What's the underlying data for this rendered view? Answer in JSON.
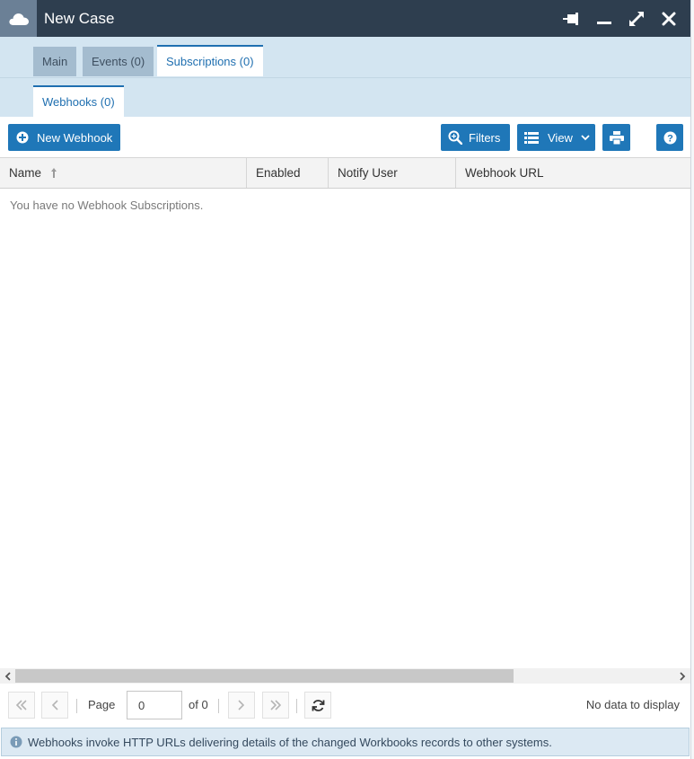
{
  "window": {
    "title": "New Case"
  },
  "colors": {
    "titlebar": "#2e3e4f",
    "accent": "#1f77b8",
    "tab_band": "#d3e5f1"
  },
  "icons": {
    "app": "cloud-icon",
    "pin": "pin-icon",
    "minimize": "minimize-icon",
    "maximize": "expand-icon",
    "close": "close-icon"
  },
  "tabs": [
    {
      "label": "Main",
      "active": false
    },
    {
      "label": "Events (0)",
      "active": false
    },
    {
      "label": "Subscriptions (0)",
      "active": true
    }
  ],
  "subtabs": [
    {
      "label": "Webhooks (0)",
      "active": true
    }
  ],
  "toolbar": {
    "new_webhook": "New Webhook",
    "filters": "Filters",
    "view": "View"
  },
  "grid": {
    "columns": [
      "Name",
      "Enabled",
      "Notify User",
      "Webhook URL"
    ],
    "sort_column": "Name",
    "sort_direction": "ascending",
    "empty_message": "You have no Webhook Subscriptions."
  },
  "pager": {
    "page_label": "Page",
    "page_value": "0",
    "of_label": "of 0",
    "status": "No data to display"
  },
  "info": {
    "message": "Webhooks invoke HTTP URLs delivering details of the changed Workbooks records to other systems."
  }
}
